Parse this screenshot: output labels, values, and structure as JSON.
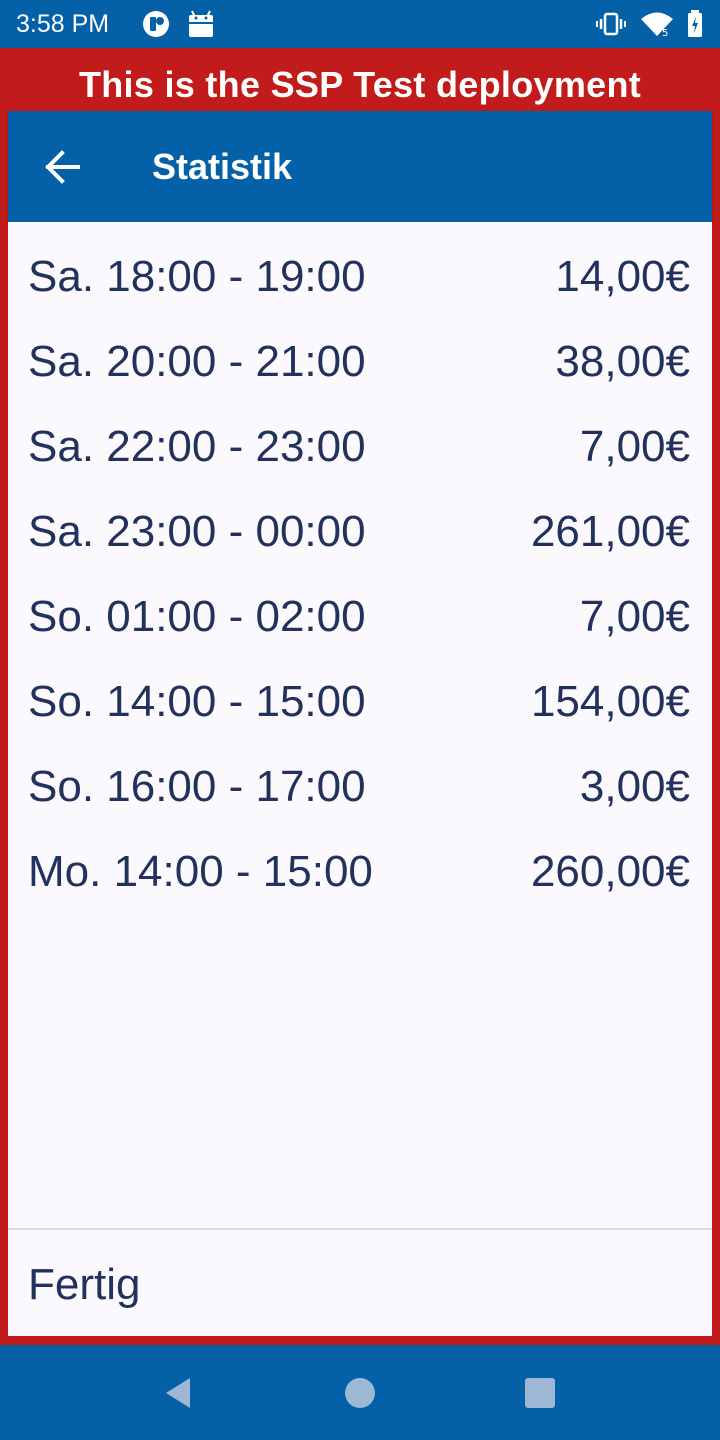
{
  "status_bar": {
    "time": "3:58 PM",
    "icons": [
      "app-notification-icon",
      "android-icon",
      "vibrate-icon",
      "wifi-icon",
      "battery-icon"
    ]
  },
  "banner": {
    "text": "This is the SSP Test deployment"
  },
  "app_bar": {
    "title": "Statistik",
    "back_icon": "arrow-left-icon"
  },
  "stats": [
    {
      "time": "Sa. 18:00 - 19:00",
      "amount": "14,00€"
    },
    {
      "time": "Sa. 20:00 - 21:00",
      "amount": "38,00€"
    },
    {
      "time": "Sa. 22:00 - 23:00",
      "amount": "7,00€"
    },
    {
      "time": "Sa. 23:00 - 00:00",
      "amount": "261,00€"
    },
    {
      "time": "So. 01:00 - 02:00",
      "amount": "7,00€"
    },
    {
      "time": "So. 14:00 - 15:00",
      "amount": "154,00€"
    },
    {
      "time": "So. 16:00 - 17:00",
      "amount": "3,00€"
    },
    {
      "time": "Mo. 14:00 - 15:00",
      "amount": "260,00€"
    }
  ],
  "footer": {
    "done_label": "Fertig"
  },
  "nav_bar": {
    "icons": [
      "back-triangle-icon",
      "home-circle-icon",
      "recents-square-icon"
    ]
  },
  "colors": {
    "primary_blue": "#0460A7",
    "frame_red": "#C21B1B",
    "text_navy": "#22325D",
    "background": "#FCF9FE"
  }
}
